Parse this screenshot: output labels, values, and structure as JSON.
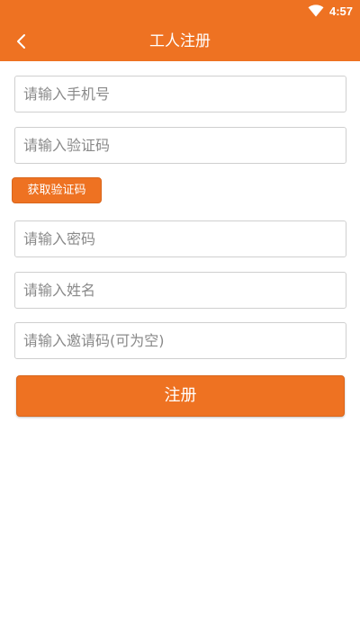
{
  "colors": {
    "accent": "#ee7222",
    "background": "#ffffff",
    "input_border": "#cfcfcf",
    "placeholder": "#8a8a8a"
  },
  "status_bar": {
    "time": "4:57",
    "wifi_icon": "wifi-icon"
  },
  "header": {
    "back_icon": "chevron-left-icon",
    "title": "工人注册"
  },
  "form": {
    "phone": {
      "placeholder": "请输入手机号",
      "value": ""
    },
    "code": {
      "placeholder": "请输入验证码",
      "value": ""
    },
    "get_code_label": "获取验证码",
    "password": {
      "placeholder": "请输入密码",
      "value": ""
    },
    "name": {
      "placeholder": "请输入姓名",
      "value": ""
    },
    "invite": {
      "placeholder": "请输入邀请码(可为空)",
      "value": ""
    },
    "submit_label": "注册"
  }
}
